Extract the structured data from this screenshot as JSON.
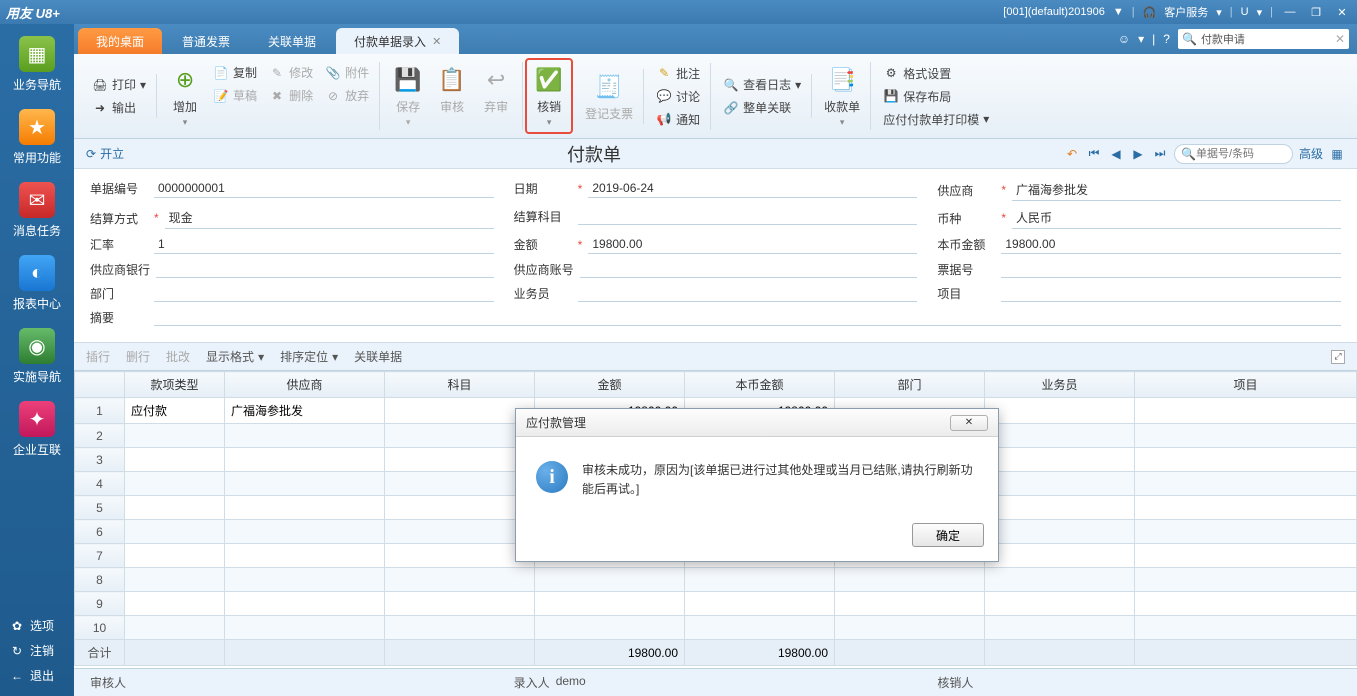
{
  "app": {
    "title": "用友 U8+",
    "account": "[001](default)201906",
    "customer_service": "客户服务",
    "u_menu": "U"
  },
  "sidebar": {
    "items": [
      {
        "label": "业务导航",
        "icon": "📋"
      },
      {
        "label": "常用功能",
        "icon": "★"
      },
      {
        "label": "消息任务",
        "icon": "✉"
      },
      {
        "label": "报表中心",
        "icon": "📊"
      },
      {
        "label": "实施导航",
        "icon": "🧭"
      },
      {
        "label": "企业互联",
        "icon": "✦"
      }
    ],
    "bottom": [
      {
        "label": "选项",
        "icon": "✿"
      },
      {
        "label": "注销",
        "icon": "↻"
      },
      {
        "label": "退出",
        "icon": "←"
      }
    ]
  },
  "tabs": [
    {
      "label": "我的桌面"
    },
    {
      "label": "普通发票"
    },
    {
      "label": "关联单据"
    },
    {
      "label": "付款单据录入",
      "active": true
    }
  ],
  "search": {
    "placeholder": "付款申请"
  },
  "toolbar": {
    "print": "打印",
    "output": "输出",
    "add": "增加",
    "copy": "复制",
    "draft": "草稿",
    "modify": "修改",
    "delete": "删除",
    "attach": "附件",
    "abandon": "放弃",
    "save": "保存",
    "audit": "审核",
    "unaudit": "弃审",
    "verify": "核销",
    "register": "登记支票",
    "note": "批注",
    "discuss": "讨论",
    "notify": "通知",
    "viewlog": "查看日志",
    "relate": "整单关联",
    "receipt": "收款单",
    "format": "格式设置",
    "savelayout": "保存布局",
    "printtpl": "应付付款单打印模"
  },
  "doc": {
    "kaili": "开立",
    "title": "付款单",
    "search_placeholder": "单据号/条码",
    "advanced": "高级",
    "fields": {
      "doc_no_label": "单据编号",
      "doc_no": "0000000001",
      "settle_label": "结算方式",
      "settle": "现金",
      "rate_label": "汇率",
      "rate": "1",
      "bank_label": "供应商银行",
      "bank": "",
      "dept_label": "部门",
      "dept": "",
      "summary_label": "摘要",
      "summary": "",
      "date_label": "日期",
      "date": "2019-06-24",
      "subject_label": "结算科目",
      "subject": "",
      "amount_label": "金额",
      "amount": "19800.00",
      "acct_label": "供应商账号",
      "acct": "",
      "clerk_label": "业务员",
      "clerk": "",
      "supplier_label": "供应商",
      "supplier": "广福海参批发",
      "currency_label": "币种",
      "currency": "人民币",
      "local_amount_label": "本币金额",
      "local_amount": "19800.00",
      "bill_no_label": "票据号",
      "bill_no": "",
      "project_label": "项目",
      "project": ""
    }
  },
  "grid_toolbar": {
    "insert_row": "插行",
    "delete_row": "删行",
    "batch": "批改",
    "display": "显示格式",
    "sort": "排序定位",
    "related": "关联单据"
  },
  "grid": {
    "headers": [
      "",
      "款项类型",
      "供应商",
      "科目",
      "金额",
      "本币金额",
      "部门",
      "业务员",
      "项目"
    ],
    "rows": [
      {
        "n": "1",
        "type": "应付款",
        "supplier": "广福海参批发",
        "subject": "",
        "amount": "19800.00",
        "local": "19800.00",
        "dept": "",
        "clerk": "",
        "project": ""
      },
      {
        "n": "2"
      },
      {
        "n": "3"
      },
      {
        "n": "4"
      },
      {
        "n": "5"
      },
      {
        "n": "6"
      },
      {
        "n": "7"
      },
      {
        "n": "8"
      },
      {
        "n": "9"
      },
      {
        "n": "10"
      }
    ],
    "total_label": "合计",
    "total_amount": "19800.00",
    "total_local": "19800.00"
  },
  "footer": {
    "auditor_label": "审核人",
    "auditor": "",
    "input_by_label": "录入人",
    "input_by": "demo",
    "verify_by_label": "核销人",
    "verify_by": ""
  },
  "dialog": {
    "title": "应付款管理",
    "message": "审核未成功，原因为[该单据已进行过其他处理或当月已结账,请执行刷新功能后再试。]",
    "ok": "确定"
  }
}
